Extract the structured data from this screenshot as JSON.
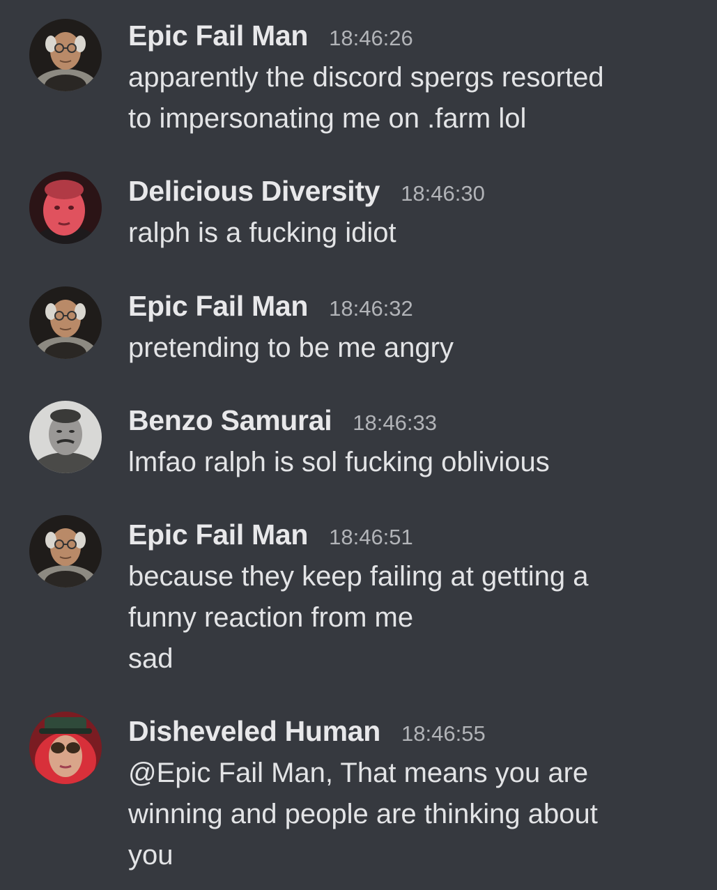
{
  "messages": [
    {
      "author": "Epic Fail Man",
      "timestamp": "18:46:26",
      "avatar_icon": "old-man-avatar-icon",
      "lines": [
        "apparently the discord spergs resorted",
        "to impersonating me on .farm lol"
      ]
    },
    {
      "author": "Delicious Diversity",
      "timestamp": "18:46:30",
      "avatar_icon": "red-face-avatar-icon",
      "lines": [
        "ralph is a fucking idiot"
      ]
    },
    {
      "author": "Epic Fail Man",
      "timestamp": "18:46:32",
      "avatar_icon": "old-man-avatar-icon",
      "lines": [
        "pretending to be me angry"
      ]
    },
    {
      "author": "Benzo Samurai",
      "timestamp": "18:46:33",
      "avatar_icon": "samurai-portrait-avatar-icon",
      "lines": [
        "lmfao ralph is sol fucking oblivious"
      ]
    },
    {
      "author": "Epic Fail Man",
      "timestamp": "18:46:51",
      "avatar_icon": "old-man-avatar-icon",
      "lines": [
        "because they keep failing at getting a",
        "funny reaction from me",
        "sad"
      ]
    },
    {
      "author": "Disheveled Human",
      "timestamp": "18:46:55",
      "avatar_icon": "red-hair-sunglasses-avatar-icon",
      "mention": "@Epic Fail Man",
      "lines": [
        ", That means you are",
        "winning and people are thinking about",
        "you"
      ]
    }
  ],
  "colors": {
    "background": "#36393f",
    "author": "#e8e8ea",
    "timestamp": "#b2b4b8",
    "message": "#e3e4e6"
  }
}
